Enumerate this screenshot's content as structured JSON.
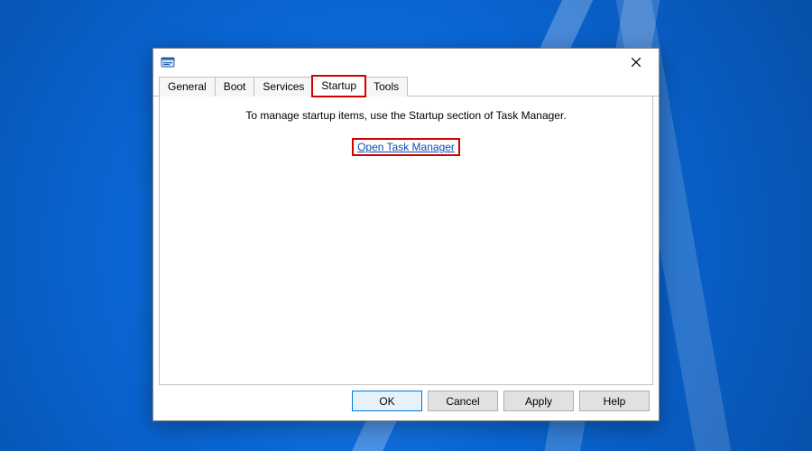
{
  "tabs": {
    "general": "General",
    "boot": "Boot",
    "services": "Services",
    "startup": "Startup",
    "tools": "Tools"
  },
  "content": {
    "message": "To manage startup items, use the Startup section of Task Manager.",
    "link": "Open Task Manager"
  },
  "buttons": {
    "ok": "OK",
    "cancel": "Cancel",
    "apply": "Apply",
    "help": "Help"
  }
}
